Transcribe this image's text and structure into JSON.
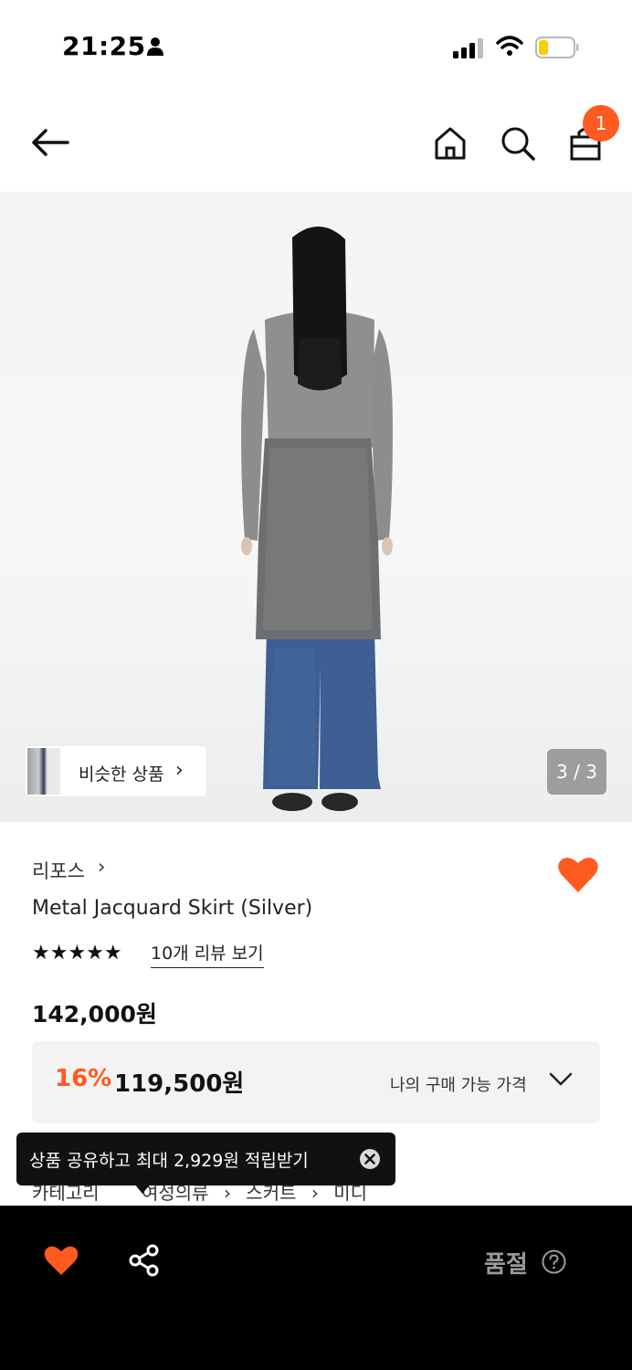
{
  "status_bar": {
    "time": "21:25"
  },
  "header": {
    "cart_count": "1"
  },
  "hero": {
    "similar_label": "비슷한 상품",
    "similar_chevron": "›",
    "pager": "3 / 3"
  },
  "product": {
    "brand": "리포스",
    "brand_chevron": "›",
    "title": "Metal Jacquard Skirt (Silver)",
    "stars": "★★★★★",
    "rating_stars": 5,
    "review_link": "10개 리뷰 보기",
    "price": "142,000원",
    "discount": "16%",
    "sale_price": "119,500원",
    "my_price_label": "나의 구매 가능 가격"
  },
  "category": {
    "label": "카테고리",
    "path": [
      "여성의류",
      "스커트",
      "미디"
    ],
    "separator": "›"
  },
  "tooltip": {
    "text": "상품 공유하고 최대 2,929원 적립받기"
  },
  "bottom_bar": {
    "soldout_label": "품절"
  },
  "colors": {
    "accent": "#ff5a1f",
    "bottom_bar": "#000000",
    "price_box": "#f3f3f3"
  },
  "icons": [
    "person-icon",
    "signal-icon",
    "wifi-icon",
    "battery-icon",
    "back-arrow-icon",
    "home-icon",
    "search-icon",
    "shopping-bag-icon",
    "heart-icon",
    "share-icon",
    "close-icon",
    "help-icon",
    "chevron-down-icon"
  ]
}
